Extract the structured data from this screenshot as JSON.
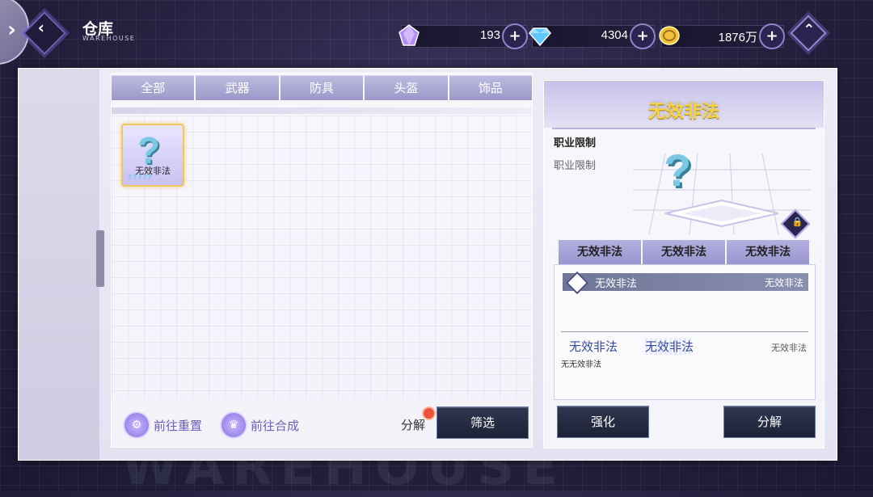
{
  "header": {
    "back_icon": "chevron-left-icon",
    "title": "仓库",
    "subtitle": "WAREHOUSE",
    "home_icon": "home-chevron-up-icon"
  },
  "resources": [
    {
      "icon": "purple-crystal-icon",
      "value": "193",
      "color": "#b58cff"
    },
    {
      "icon": "blue-diamond-icon",
      "value": "4304",
      "color": "#5fc7ff"
    },
    {
      "icon": "gold-coin-icon",
      "value": "1876万",
      "color": "#f0c040"
    }
  ],
  "inventory": {
    "tabs": [
      "全部",
      "武器",
      "防具",
      "头盔",
      "饰品"
    ],
    "items": [
      {
        "name": "无效非法",
        "icon": "question-mark-icon",
        "stars": "?????"
      }
    ],
    "go_reset_label": "前往重置",
    "go_synth_label": "前往合成",
    "decompose_label": "分解",
    "filter_label": "筛选"
  },
  "details": {
    "title": "无效非法",
    "job_limit_label": "职业限制",
    "job_limit_value": "职业限制",
    "sub_tabs": [
      "无效非法",
      "无效非法",
      "无效非法"
    ],
    "stat": {
      "name": "无效非法",
      "value": "无效非法"
    },
    "effects": {
      "a": "无效非法",
      "b": "无效非法",
      "c": "无效非法",
      "d": "无无效非法"
    },
    "enhance_label": "强化",
    "decompose_label": "分解"
  },
  "colors": {
    "accent_gold": "#f5d24a",
    "dark_button": "#1c2236",
    "tab_purple": "#9c98c8"
  }
}
